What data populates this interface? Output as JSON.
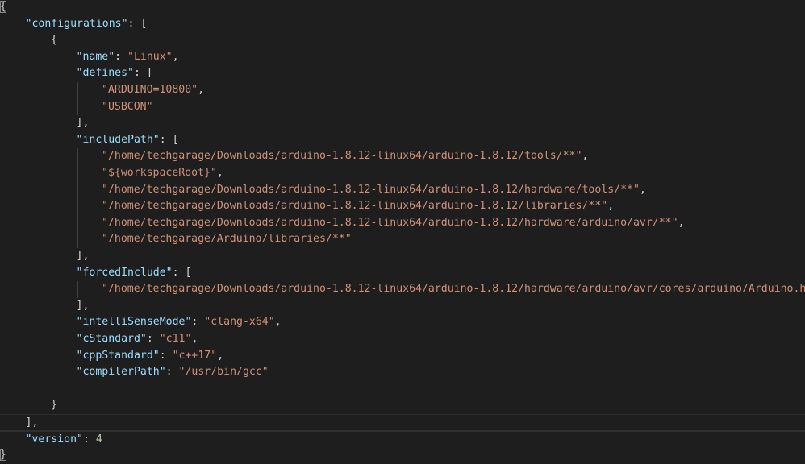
{
  "editor": {
    "language": "json",
    "theme_colors": {
      "background": "#1e1e1e",
      "key": "#9cdcfe",
      "string": "#ce9178",
      "number": "#b5cea8",
      "punctuation": "#d4d4d4"
    },
    "lines": [
      {
        "indent": 0,
        "tokens": [
          {
            "t": "punct",
            "v": "{"
          }
        ]
      },
      {
        "indent": 1,
        "tokens": [
          {
            "t": "key",
            "v": "\"configurations\""
          },
          {
            "t": "punct",
            "v": ": ["
          }
        ]
      },
      {
        "indent": 2,
        "tokens": [
          {
            "t": "punct",
            "v": "{"
          }
        ]
      },
      {
        "indent": 3,
        "tokens": [
          {
            "t": "key",
            "v": "\"name\""
          },
          {
            "t": "punct",
            "v": ": "
          },
          {
            "t": "str",
            "v": "\"Linux\""
          },
          {
            "t": "punct",
            "v": ","
          }
        ]
      },
      {
        "indent": 3,
        "tokens": [
          {
            "t": "key",
            "v": "\"defines\""
          },
          {
            "t": "punct",
            "v": ": ["
          }
        ]
      },
      {
        "indent": 4,
        "tokens": [
          {
            "t": "str",
            "v": "\"ARDUINO=10800\""
          },
          {
            "t": "punct",
            "v": ","
          }
        ]
      },
      {
        "indent": 4,
        "tokens": [
          {
            "t": "str",
            "v": "\"USBCON\""
          }
        ]
      },
      {
        "indent": 3,
        "tokens": [
          {
            "t": "punct",
            "v": "],"
          }
        ]
      },
      {
        "indent": 3,
        "tokens": [
          {
            "t": "key",
            "v": "\"includePath\""
          },
          {
            "t": "punct",
            "v": ": ["
          }
        ]
      },
      {
        "indent": 4,
        "tokens": [
          {
            "t": "str",
            "v": "\"/home/techgarage/Downloads/arduino-1.8.12-linux64/arduino-1.8.12/tools/**\""
          },
          {
            "t": "punct",
            "v": ","
          }
        ]
      },
      {
        "indent": 4,
        "tokens": [
          {
            "t": "str",
            "v": "\"${workspaceRoot}\""
          },
          {
            "t": "punct",
            "v": ","
          }
        ]
      },
      {
        "indent": 4,
        "tokens": [
          {
            "t": "str",
            "v": "\"/home/techgarage/Downloads/arduino-1.8.12-linux64/arduino-1.8.12/hardware/tools/**\""
          },
          {
            "t": "punct",
            "v": ","
          }
        ]
      },
      {
        "indent": 4,
        "tokens": [
          {
            "t": "str",
            "v": "\"/home/techgarage/Downloads/arduino-1.8.12-linux64/arduino-1.8.12/libraries/**\""
          },
          {
            "t": "punct",
            "v": ","
          }
        ]
      },
      {
        "indent": 4,
        "tokens": [
          {
            "t": "str",
            "v": "\"/home/techgarage/Downloads/arduino-1.8.12-linux64/arduino-1.8.12/hardware/arduino/avr/**\""
          },
          {
            "t": "punct",
            "v": ","
          }
        ]
      },
      {
        "indent": 4,
        "tokens": [
          {
            "t": "str",
            "v": "\"/home/techgarage/Arduino/libraries/**\""
          }
        ]
      },
      {
        "indent": 3,
        "tokens": [
          {
            "t": "punct",
            "v": "],"
          }
        ]
      },
      {
        "indent": 3,
        "tokens": [
          {
            "t": "key",
            "v": "\"forcedInclude\""
          },
          {
            "t": "punct",
            "v": ": ["
          }
        ]
      },
      {
        "indent": 4,
        "tokens": [
          {
            "t": "str",
            "v": "\"/home/techgarage/Downloads/arduino-1.8.12-linux64/arduino-1.8.12/hardware/arduino/avr/cores/arduino/Arduino.h\""
          }
        ]
      },
      {
        "indent": 3,
        "tokens": [
          {
            "t": "punct",
            "v": "],"
          }
        ]
      },
      {
        "indent": 3,
        "tokens": [
          {
            "t": "key",
            "v": "\"intelliSenseMode\""
          },
          {
            "t": "punct",
            "v": ": "
          },
          {
            "t": "str",
            "v": "\"clang-x64\""
          },
          {
            "t": "punct",
            "v": ","
          }
        ]
      },
      {
        "indent": 3,
        "tokens": [
          {
            "t": "key",
            "v": "\"cStandard\""
          },
          {
            "t": "punct",
            "v": ": "
          },
          {
            "t": "str",
            "v": "\"c11\""
          },
          {
            "t": "punct",
            "v": ","
          }
        ]
      },
      {
        "indent": 3,
        "tokens": [
          {
            "t": "key",
            "v": "\"cppStandard\""
          },
          {
            "t": "punct",
            "v": ": "
          },
          {
            "t": "str",
            "v": "\"c++17\""
          },
          {
            "t": "punct",
            "v": ","
          }
        ]
      },
      {
        "indent": 3,
        "tokens": [
          {
            "t": "key",
            "v": "\"compilerPath\""
          },
          {
            "t": "punct",
            "v": ": "
          },
          {
            "t": "str",
            "v": "\"/usr/bin/gcc\""
          }
        ]
      },
      {
        "indent": 3,
        "tokens": []
      },
      {
        "indent": 2,
        "tokens": [
          {
            "t": "punct",
            "v": "}"
          }
        ]
      },
      {
        "indent": 1,
        "tokens": [
          {
            "t": "punct",
            "v": "],"
          }
        ]
      },
      {
        "indent": 1,
        "tokens": [
          {
            "t": "key",
            "v": "\"version\""
          },
          {
            "t": "punct",
            "v": ": "
          },
          {
            "t": "num",
            "v": "4"
          }
        ]
      },
      {
        "indent": 0,
        "tokens": [
          {
            "t": "punct",
            "v": "}"
          }
        ]
      }
    ]
  }
}
